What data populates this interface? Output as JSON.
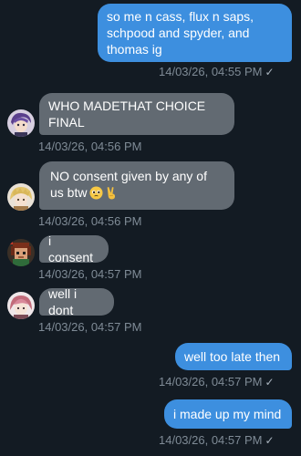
{
  "messages": [
    {
      "id": "m1",
      "direction": "outgoing",
      "text": "so me n cass, flux n saps,\nschpood and spyder, and\nthomas ig",
      "timestamp": "14/03/26, 04:55 PM",
      "read_mark": "✓"
    },
    {
      "id": "m2",
      "direction": "incoming",
      "avatar": "purple-hair-avatar",
      "text": "WHO MADETHAT CHOICE\nFINAL",
      "timestamp": "14/03/26, 04:56 PM"
    },
    {
      "id": "m3",
      "direction": "incoming",
      "avatar": "blonde-avatar",
      "text": "NO consent given by any of\nus btw",
      "emojis": [
        "pleading-face",
        "victory-hand"
      ],
      "timestamp": "14/03/26, 04:56 PM"
    },
    {
      "id": "m4",
      "direction": "incoming",
      "avatar": "pixel-avatar",
      "text": "i consent",
      "timestamp": "14/03/26, 04:57 PM"
    },
    {
      "id": "m5",
      "direction": "incoming",
      "avatar": "pink-hair-avatar",
      "text": "well i dont",
      "timestamp": "14/03/26, 04:57 PM"
    },
    {
      "id": "m6",
      "direction": "outgoing",
      "text": "well too late then",
      "timestamp": "14/03/26, 04:57 PM",
      "read_mark": "✓"
    },
    {
      "id": "m7",
      "direction": "outgoing",
      "text": "i made up my mind",
      "timestamp": "14/03/26, 04:57 PM",
      "read_mark": "✓"
    }
  ],
  "colors": {
    "background": "#131b23",
    "outgoing_bubble": "#3d8fdf",
    "incoming_bubble": "#626a72",
    "timestamp": "#7f8b96"
  }
}
